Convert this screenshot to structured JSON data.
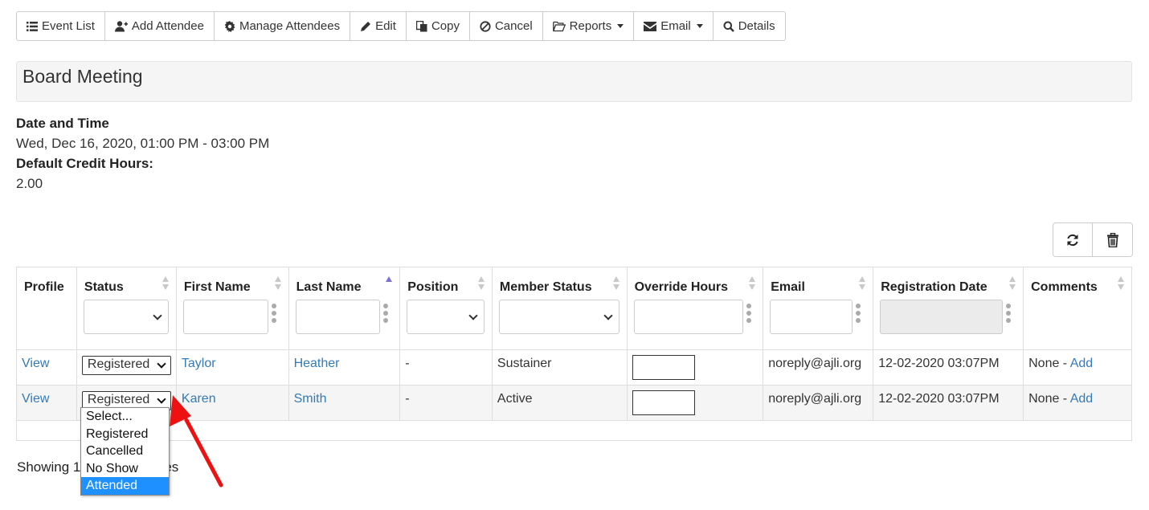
{
  "toolbar": {
    "event_list": "Event List",
    "add_attendee": "Add Attendee",
    "manage_attendees": "Manage Attendees",
    "edit": "Edit",
    "copy": "Copy",
    "cancel": "Cancel",
    "reports": "Reports",
    "email": "Email",
    "details": "Details"
  },
  "event": {
    "title": "Board Meeting",
    "date_time_label": "Date and Time",
    "date_time_value": "Wed, Dec 16, 2020, 01:00 PM - 03:00 PM",
    "credit_hours_label": "Default Credit Hours:",
    "credit_hours_value": "2.00"
  },
  "table": {
    "headers": {
      "profile": "Profile",
      "status": "Status",
      "first_name": "First Name",
      "last_name": "Last Name",
      "position": "Position",
      "member_status": "Member Status",
      "override_hours": "Override Hours",
      "email": "Email",
      "registration_date": "Registration Date",
      "comments": "Comments"
    },
    "rows": [
      {
        "profile": "View",
        "status": "Registered",
        "first_name": "Taylor",
        "last_name": "Heather",
        "position": "-",
        "member_status": "Sustainer",
        "email": "noreply@ajli.org",
        "registration_date": "12-02-2020 03:07PM",
        "comments_prefix": "None - ",
        "comments_link": "Add"
      },
      {
        "profile": "View",
        "status": "Registered",
        "first_name": "Karen",
        "last_name": "Smith",
        "position": "-",
        "member_status": "Active",
        "email": "noreply@ajli.org",
        "registration_date": "12-02-2020 03:07PM",
        "comments_prefix": "None - ",
        "comments_link": "Add"
      }
    ]
  },
  "status_dropdown": {
    "options": [
      "Select...",
      "Registered",
      "Cancelled",
      "No Show",
      "Attended"
    ],
    "highlighted": "Attended"
  },
  "footer": {
    "showing": "Showing 1 to 2 of 2 entries"
  },
  "colors": {
    "link": "#337ab7",
    "highlight": "#1e90ff",
    "annotation_arrow": "#ee1111"
  }
}
